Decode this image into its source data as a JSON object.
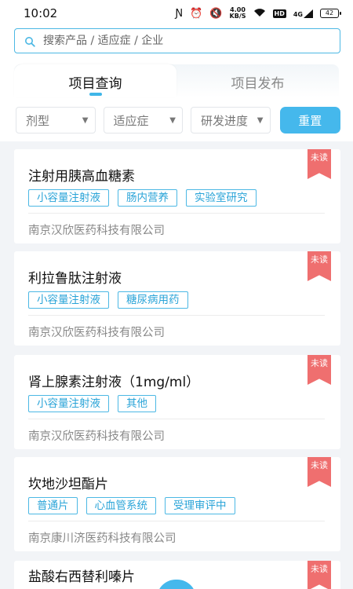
{
  "status_bar": {
    "time": "10:02",
    "net_speed_value": "4.00",
    "net_speed_unit": "KB/S",
    "signal_label": "4G",
    "hd_label": "HD",
    "battery": "42"
  },
  "search": {
    "placeholder": "搜索产品 / 适应症 / 企业"
  },
  "tabs": [
    {
      "label": "项目查询",
      "active": true
    },
    {
      "label": "项目发布",
      "active": false
    }
  ],
  "filters": [
    {
      "label": "剂型"
    },
    {
      "label": "适应症"
    },
    {
      "label": "研发进度"
    }
  ],
  "reset_label": "重置",
  "unread_label": "未读",
  "items": [
    {
      "title": "注射用胰高血糖素",
      "tags": [
        "小容量注射液",
        "肠内营养",
        "实验室研究"
      ],
      "company": "南京汉欣医药科技有限公司"
    },
    {
      "title": "利拉鲁肽注射液",
      "tags": [
        "小容量注射液",
        "糖尿病用药"
      ],
      "company": "南京汉欣医药科技有限公司"
    },
    {
      "title": "肾上腺素注射液（1mg/ml）",
      "tags": [
        "小容量注射液",
        "其他"
      ],
      "company": "南京汉欣医药科技有限公司"
    },
    {
      "title": "坎地沙坦酯片",
      "tags": [
        "普通片",
        "心血管系统",
        "受理审评中"
      ],
      "company": "南京康川济医药科技有限公司"
    },
    {
      "title": "盐酸右西替利嗪片",
      "tags": [],
      "company": ""
    }
  ],
  "colors": {
    "accent": "#45b8ec",
    "tag_border": "#4cb8e4",
    "unread": "#ef6f6f"
  }
}
